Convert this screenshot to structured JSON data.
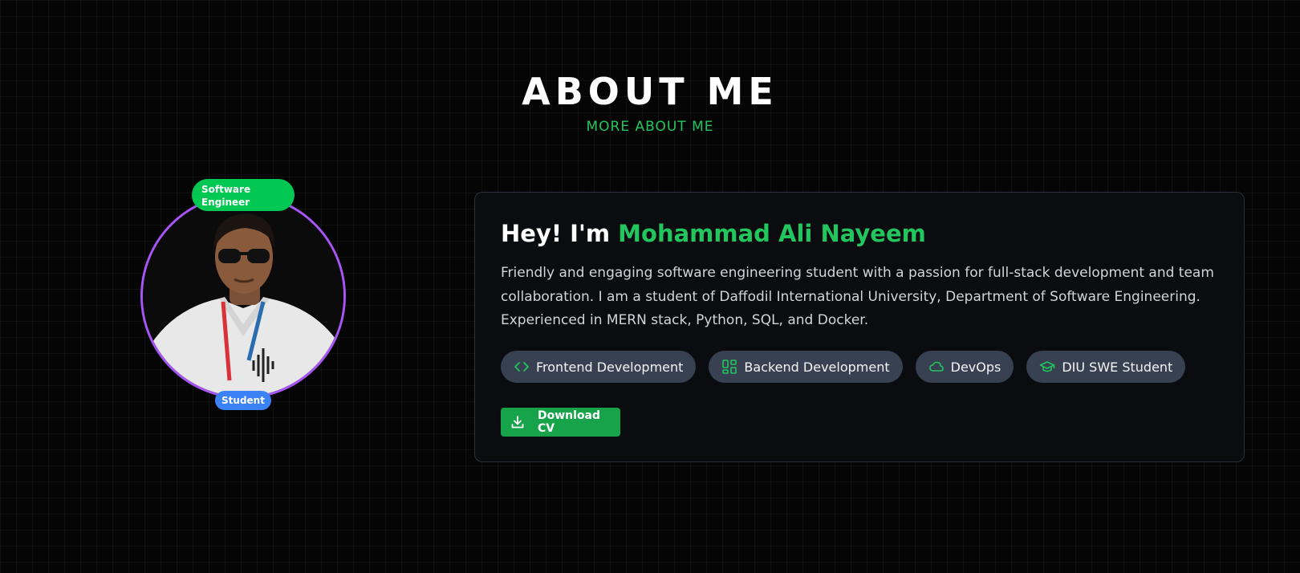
{
  "section": {
    "title": "ABOUT ME",
    "subtitle": "MORE ABOUT ME"
  },
  "profile": {
    "badge_top": "Software Engineer",
    "badge_bottom": "Student",
    "ring_color": "#a855f7"
  },
  "card": {
    "greeting_prefix": "Hey! I'm",
    "name": "Mohammad Ali Nayeem",
    "bio": "Friendly and engaging software engineering student with a passion for full-stack development and team collaboration. I am a student of Daffodil International University, Department of Software Engineering. Experienced in MERN stack, Python, SQL, and Docker.",
    "tags": [
      {
        "icon": "code-icon",
        "label": "Frontend Development"
      },
      {
        "icon": "grid-icon",
        "label": "Backend Development"
      },
      {
        "icon": "cloud-icon",
        "label": "DevOps"
      },
      {
        "icon": "graduation-cap-icon",
        "label": "DIU SWE Student"
      }
    ],
    "download_label": "Download CV"
  },
  "colors": {
    "accent": "#22c55e",
    "badge_green": "#00c853",
    "badge_blue": "#3b82f6",
    "background": "#050505"
  }
}
